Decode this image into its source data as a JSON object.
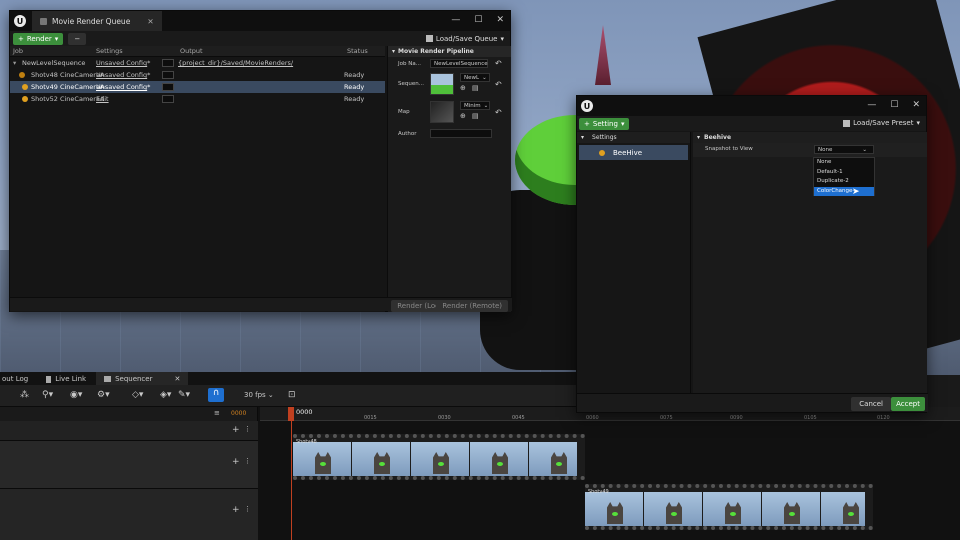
{
  "mrq": {
    "title": "Movie Render Queue",
    "render_btn": "Render",
    "minus_btn": "−",
    "load_save": "Load/Save Queue",
    "headers": {
      "job": "Job",
      "settings": "Settings",
      "output": "Output",
      "status": "Status"
    },
    "parent": {
      "job": "NewLevelSequence",
      "settings": "Unsaved Config",
      "star": "*",
      "output": "{project_dir}/Saved/MovieRenders/"
    },
    "jobs": [
      {
        "job": "Shotv48 CineCameraA",
        "settings": "Unsaved Config",
        "star": "*",
        "status": "Ready"
      },
      {
        "job": "Shotv49 CineCameraA",
        "settings": "Unsaved Config",
        "star": "*",
        "status": "Ready"
      },
      {
        "job": "Shotv52 CineCameraA",
        "settings": "Edit",
        "star": "",
        "status": "Ready"
      }
    ],
    "pipeline": {
      "header": "Movie Render Pipeline",
      "job_name_label": "Job Na...",
      "job_name_value": "NewLevelSequence",
      "sequence_label": "Sequen...",
      "sequence_value": "NewL",
      "map_label": "Map",
      "map_value": "Minim",
      "author_label": "Author",
      "author_value": ""
    },
    "render_local": "Render (Local)",
    "render_remote": "Render (Remote)"
  },
  "preset": {
    "setting_btn": "Setting",
    "load_save": "Load/Save Preset",
    "tree_header": "Settings",
    "tree_item": "BeeHive",
    "detail_header": "Beehive",
    "snapshot_label": "Snapshot to View",
    "snapshot_value": "None",
    "options": [
      "None",
      "Default-1",
      "Duplicate-2",
      "ColorChange-"
    ],
    "cancel": "Cancel",
    "accept": "Accept"
  },
  "tabs": {
    "output_log": "out Log",
    "live_link": "Live Link",
    "sequencer": "Sequencer"
  },
  "sequencer": {
    "fps": "30 fps",
    "frame_start": "0000",
    "playhead": "0000",
    "ticks": [
      "0015",
      "0030",
      "0045",
      "0060",
      "0075",
      "0090",
      "0105",
      "0120"
    ],
    "clip1_label": "Shotv48",
    "clip2_label": "Shotv49"
  },
  "colors": {
    "accent_green": "#3c8f3c",
    "selection_blue": "#1e6fd0",
    "status_orange": "#e0a020"
  }
}
